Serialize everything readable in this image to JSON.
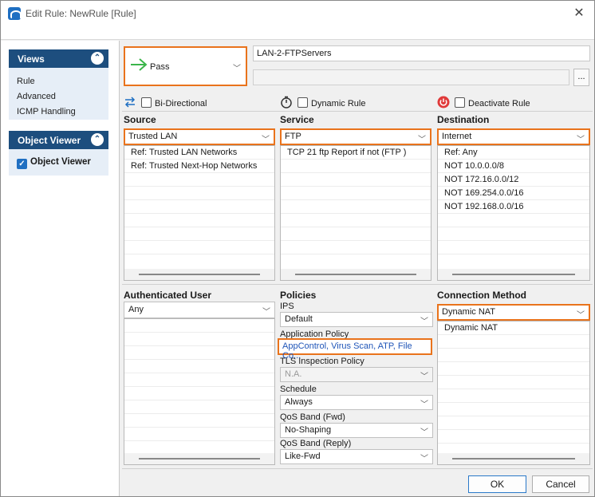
{
  "window": {
    "title": "Edit Rule: NewRule [Rule]"
  },
  "sidebar": {
    "views_header": "Views",
    "views_items": [
      "Rule",
      "Advanced",
      "ICMP Handling"
    ],
    "object_viewer_header": "Object Viewer",
    "object_viewer_item": "Object Viewer"
  },
  "rule": {
    "action": "Pass",
    "name": "LAN-2-FTPServers",
    "description": "",
    "more_label": "...",
    "options": {
      "bidirectional": "Bi-Directional",
      "dynamic_rule": "Dynamic Rule",
      "deactivate_rule": "Deactivate Rule"
    }
  },
  "source": {
    "label": "Source",
    "selected": "Trusted LAN",
    "items": [
      "Ref: Trusted LAN Networks",
      "Ref: Trusted Next-Hop Networks"
    ]
  },
  "service": {
    "label": "Service",
    "selected": "FTP",
    "items": [
      "TCP  21 ftp  Report if not (FTP )"
    ]
  },
  "destination": {
    "label": "Destination",
    "selected": "Internet",
    "items": [
      "Ref: Any",
      "NOT 10.0.0.0/8",
      "NOT 172.16.0.0/12",
      "NOT 169.254.0.0/16",
      "NOT 192.168.0.0/16"
    ]
  },
  "authenticated_user": {
    "label": "Authenticated User",
    "selected": "Any"
  },
  "policies": {
    "label": "Policies",
    "ips_label": "IPS",
    "ips_value": "Default",
    "app_policy_label": "Application Policy",
    "app_policy_value": "AppControl, Virus Scan, ATP, File Co...",
    "tls_label": "TLS Inspection Policy",
    "tls_value": "N.A.",
    "schedule_label": "Schedule",
    "schedule_value": "Always",
    "qos_fwd_label": "QoS Band (Fwd)",
    "qos_fwd_value": "No-Shaping",
    "qos_reply_label": "QoS Band (Reply)",
    "qos_reply_value": "Like-Fwd"
  },
  "connection_method": {
    "label": "Connection Method",
    "selected": "Dynamic NAT",
    "items": [
      "Dynamic NAT"
    ]
  },
  "buttons": {
    "ok": "OK",
    "cancel": "Cancel"
  },
  "colors": {
    "highlight": "#e9731c",
    "panel_header": "#1d4e7e",
    "link": "#1f55b8"
  }
}
